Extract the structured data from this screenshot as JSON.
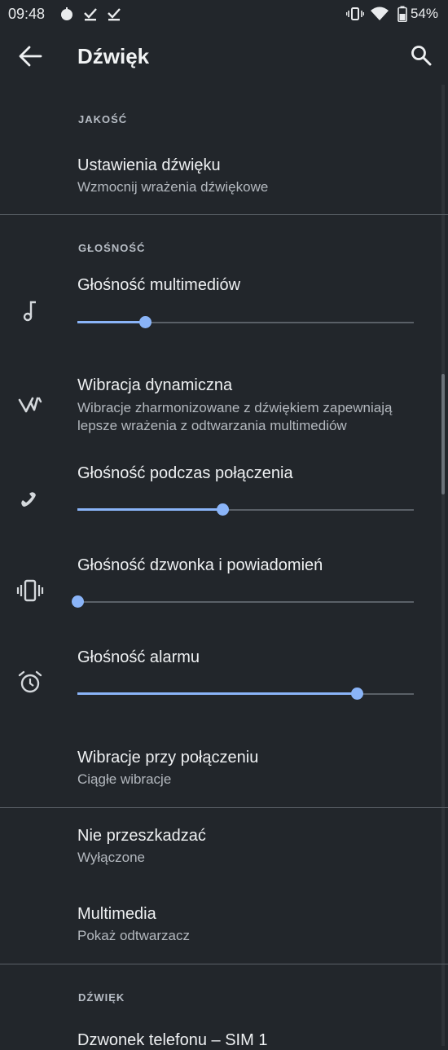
{
  "status_bar": {
    "time": "09:48",
    "battery": "54%"
  },
  "app_bar": {
    "title": "Dźwięk"
  },
  "sections": {
    "quality_header": "JAKOŚĆ",
    "volume_header": "GŁOŚNOŚĆ",
    "sound_header": "DŹWIĘK"
  },
  "items": {
    "sound_settings": {
      "title": "Ustawienia dźwięku",
      "subtitle": "Wzmocnij wrażenia dźwiękowe"
    },
    "media_volume": {
      "title": "Głośność multimediów",
      "level": 0.2
    },
    "dynamic_vibration": {
      "title": "Wibracja dynamiczna",
      "subtitle_line1": "Wibracje zharmonizowane z dźwiękiem zapewniają",
      "subtitle_line2": "lepsze wrażenia z odtwarzania multimediów"
    },
    "call_volume": {
      "title": "Głośność podczas połączenia",
      "level": 0.43
    },
    "ring_volume": {
      "title": "Głośność dzwonka i powiadomień",
      "level": 0.0
    },
    "alarm_volume": {
      "title": "Głośność alarmu",
      "level": 0.83
    },
    "vibrate_calls": {
      "title": "Wibracje przy połączeniu",
      "subtitle": "Ciągłe wibracje"
    },
    "dnd": {
      "title": "Nie przeszkadzać",
      "subtitle": "Wyłączone"
    },
    "media": {
      "title": "Multimedia",
      "subtitle": "Pokaż odtwarzacz"
    },
    "ringtone": {
      "title": "Dzwonek telefonu – SIM 1"
    }
  },
  "colors": {
    "accent": "#8ab4f8",
    "background": "#22262b"
  }
}
